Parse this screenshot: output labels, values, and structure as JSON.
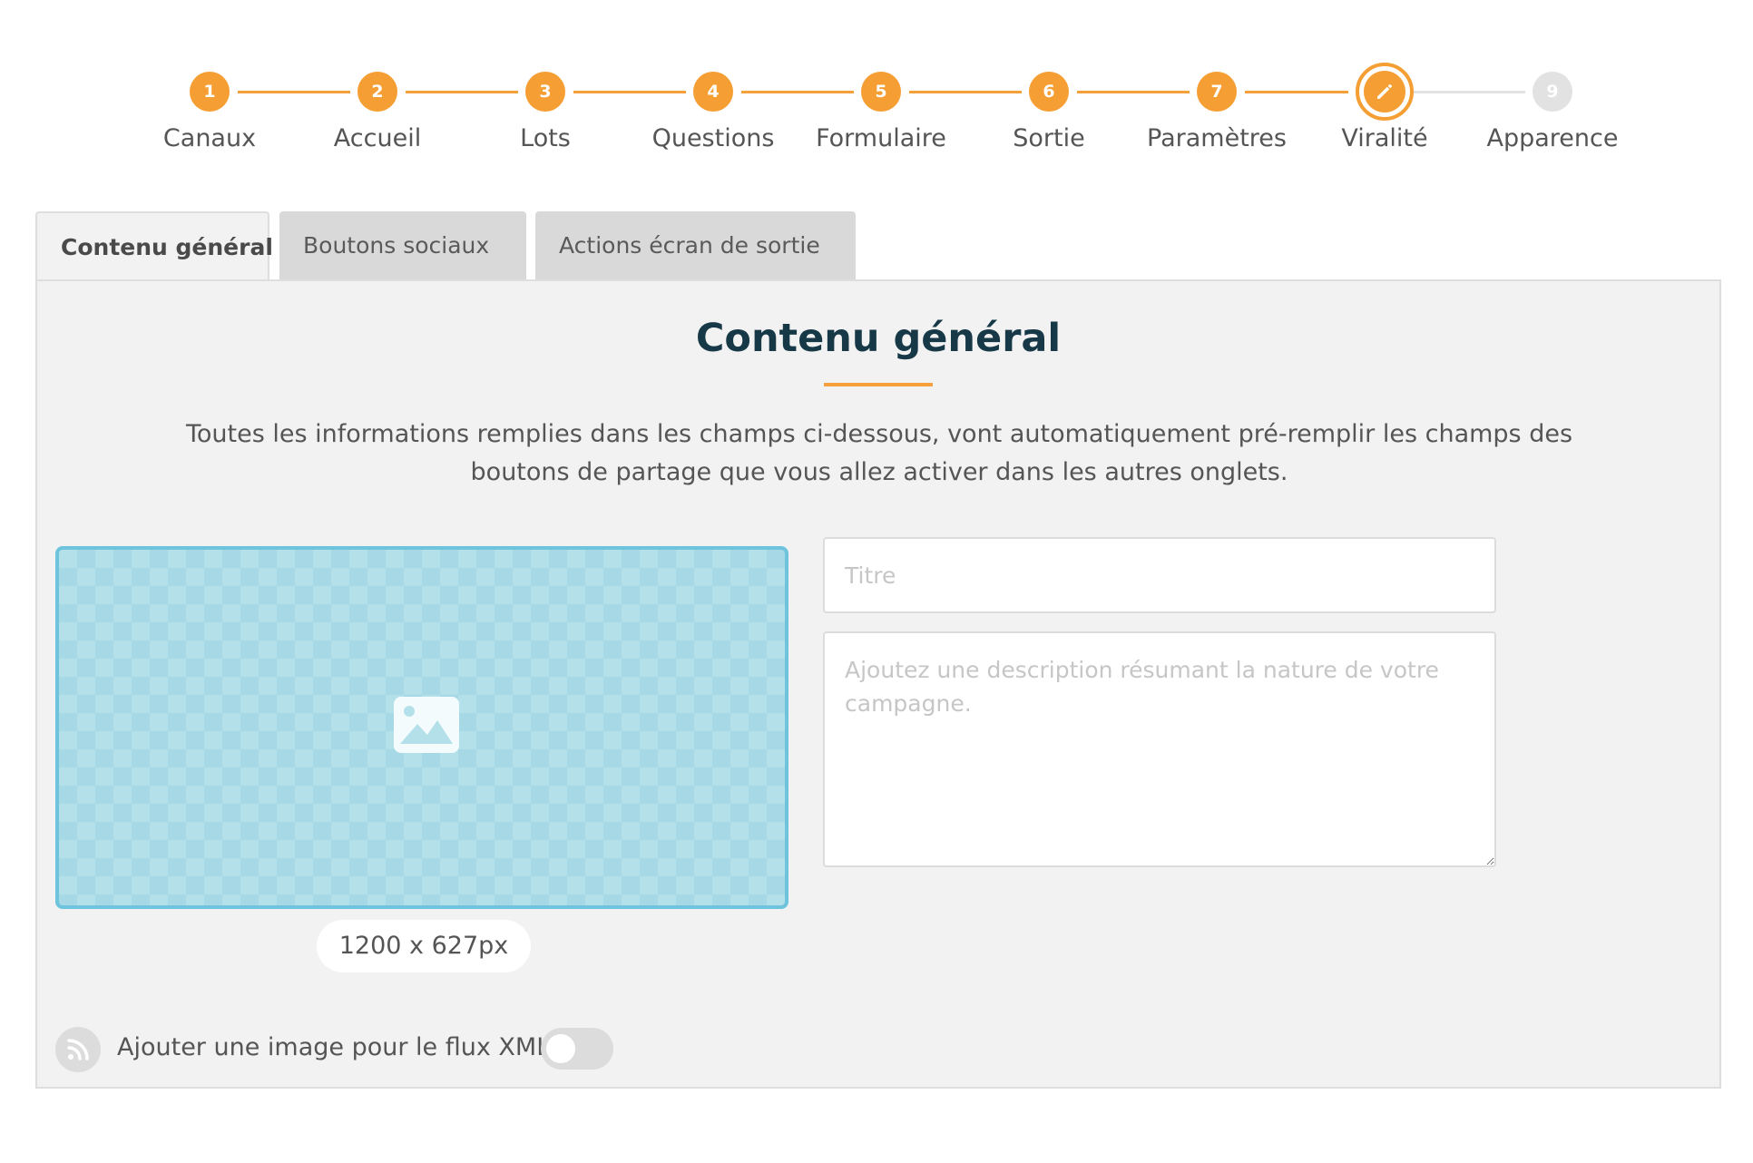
{
  "stepper": {
    "steps": [
      {
        "number": "1",
        "label": "Canaux",
        "state": "done"
      },
      {
        "number": "2",
        "label": "Accueil",
        "state": "done"
      },
      {
        "number": "3",
        "label": "Lots",
        "state": "done"
      },
      {
        "number": "4",
        "label": "Questions",
        "state": "done"
      },
      {
        "number": "5",
        "label": "Formulaire",
        "state": "done"
      },
      {
        "number": "6",
        "label": "Sortie",
        "state": "done"
      },
      {
        "number": "7",
        "label": "Paramètres",
        "state": "done"
      },
      {
        "number": "",
        "label": "Viralité",
        "state": "current",
        "icon": "pencil-icon"
      },
      {
        "number": "9",
        "label": "Apparence",
        "state": "todo"
      }
    ],
    "colors": {
      "done": "#f59e33",
      "todo": "#e2e2e2"
    }
  },
  "tabs": [
    {
      "label": "Contenu général",
      "active": true
    },
    {
      "label": "Boutons sociaux",
      "active": false
    },
    {
      "label": "Actions écran de sortie",
      "active": false
    }
  ],
  "panel": {
    "title": "Contenu général",
    "description": "Toutes les informations remplies dans les champs ci-dessous, vont automatiquement pré-remplir les champs des boutons de partage que vous allez activer dans les autres onglets.",
    "image_icon": "image-icon",
    "image_size": "1200 x 627px",
    "title_value": "",
    "title_placeholder": "Titre",
    "description_value": "",
    "description_placeholder": "Ajoutez une description résumant la nature de votre campagne.",
    "rss_icon": "rss-icon",
    "xml_label": "Ajouter une image pour le flux XML",
    "xml_toggle_on": false
  }
}
